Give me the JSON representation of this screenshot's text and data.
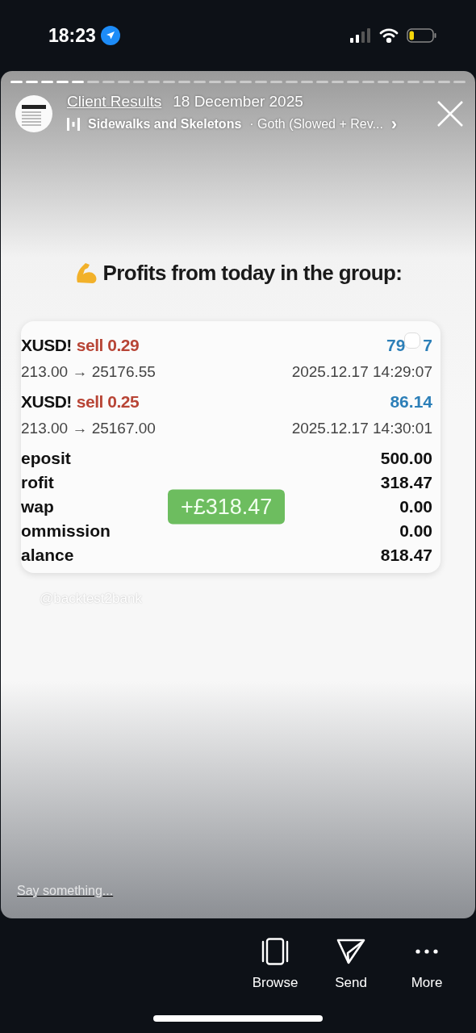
{
  "status_bar": {
    "time": "18:23",
    "location_active": true
  },
  "story": {
    "segments": [
      {
        "seen": true
      },
      {
        "seen": true
      },
      {
        "seen": true
      },
      {
        "seen": true
      },
      {
        "seen": true
      },
      {
        "seen": false
      },
      {
        "seen": false
      },
      {
        "seen": false
      },
      {
        "seen": false
      },
      {
        "seen": false
      },
      {
        "seen": false
      },
      {
        "seen": false
      },
      {
        "seen": false
      },
      {
        "seen": false
      },
      {
        "seen": false
      },
      {
        "seen": false
      },
      {
        "seen": false
      },
      {
        "seen": false
      },
      {
        "seen": false
      },
      {
        "seen": false
      },
      {
        "seen": false
      },
      {
        "seen": false
      },
      {
        "seen": false
      },
      {
        "seen": false
      },
      {
        "seen": false
      },
      {
        "seen": false
      },
      {
        "seen": false
      },
      {
        "seen": false
      },
      {
        "seen": false
      },
      {
        "seen": false
      }
    ],
    "author": "Client Results",
    "date": "18 December 2025",
    "song": "Sidewalks and Skeletons",
    "song_detail": "· Goth (Slowed + Rev...",
    "chevron": "›"
  },
  "post": {
    "heading": "Profits from today in the group:",
    "trades": [
      {
        "symbol": "XUSD!",
        "action": "sell 0.29",
        "prices": "213.00 → 25176.55",
        "profit": "79",
        "profit_tail": "7",
        "time": "2025.12.17 14:29:07"
      },
      {
        "symbol": "XUSD!",
        "action": "sell 0.25",
        "prices": "213.00 → 25167.00",
        "profit": "86.14",
        "time": "2025.12.17 14:30:01"
      }
    ],
    "summary": [
      {
        "label": "eposit",
        "value": "500.00"
      },
      {
        "label": "rofit",
        "value": "318.47"
      },
      {
        "label": "wap",
        "value": "0.00"
      },
      {
        "label": "ommission",
        "value": "0.00"
      },
      {
        "label": "alance",
        "value": "818.47"
      }
    ],
    "badge": "+£318.47",
    "handle": "@backtest2bank"
  },
  "reply": {
    "placeholder": "Say something..."
  },
  "actions": [
    {
      "kind": "browse",
      "label": "Browse"
    },
    {
      "kind": "send",
      "label": "Send"
    },
    {
      "kind": "more",
      "label": "More"
    }
  ]
}
